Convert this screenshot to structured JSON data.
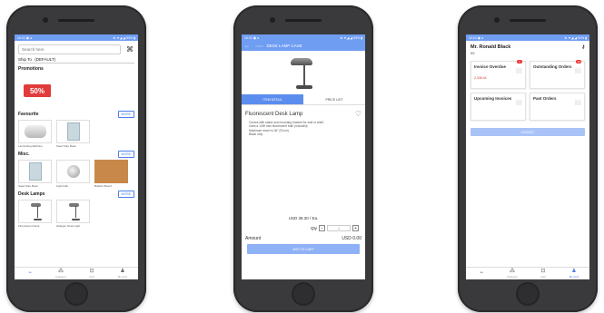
{
  "phone1": {
    "status": {
      "time": "10:22 ▣ ●",
      "right": "⊗ ▼◢ ◢ 93% ▮"
    },
    "search": {
      "placeholder": "Search here"
    },
    "scan_icon": "⌘",
    "ship_to": {
      "label": "Ship To",
      "value": "(DEFAULT)"
    },
    "promotions": {
      "title": "Promotions",
      "tag": "50%"
    },
    "favourite": {
      "title": "Favourite",
      "more": "MORE",
      "items": [
        "Laminating Machine",
        "Steel Note Book"
      ]
    },
    "misc": {
      "title": "Misc.",
      "more": "MORE",
      "items": [
        "Steel Note Book",
        "Light bulb",
        "Bulletin Board"
      ]
    },
    "desk_lamps": {
      "title": "Desk Lamps",
      "more": "MORE",
      "items": [
        "Fluorescent Desk",
        "Halogen Desk Light"
      ]
    },
    "nav": [
      {
        "icon": "⌁",
        "label": ""
      },
      {
        "icon": "⁂",
        "label": "Category"
      },
      {
        "icon": "⊡",
        "label": "Cart"
      },
      {
        "icon": "♟",
        "label": "My Acct"
      }
    ]
  },
  "phone2": {
    "status": {
      "time": "10:22 ▣ ●",
      "right": "⊗ ▼◢ ◢ 93% ▮"
    },
    "appbar": {
      "back": "←",
      "logo": "▭▭▭",
      "title": "DESK LAMP CASE"
    },
    "tabs": [
      "ITEM DETAIL",
      "PRICE LIST"
    ],
    "product": {
      "title": "Fluorescent Desk Lamp",
      "bullets": [
        "Comes with stand and mounting bracket for wall or shelf.",
        "Uses a 13W mini fluorescent bulb (included).",
        "Maximum reach is 36\" (91cm).",
        "Black only."
      ],
      "price": "USD  38.30 /  Ea.",
      "qty_label": "Qty",
      "qty_minus": "−",
      "qty_value": "1",
      "qty_plus": "+",
      "amount_label": "Amount",
      "amount_value": "USD  0.00",
      "add_to_cart": "ADD TO CART"
    }
  },
  "phone3": {
    "status": {
      "time": "10:24 ▣ ●",
      "right": "⊗ ▼◢ ◢ 94% ▮"
    },
    "customer": {
      "name": "Mr. Ronald Black",
      "id": "95"
    },
    "cards": [
      {
        "title": "Invoice Overdue",
        "value": "2,338.44",
        "badge": "1"
      },
      {
        "title": "Outstanding Orders",
        "value": "",
        "badge": "10"
      },
      {
        "title": "Upcoming Invoices",
        "value": "",
        "badge": ""
      },
      {
        "title": "Past Orders",
        "value": "",
        "badge": ""
      }
    ],
    "logout": "LOGOUT",
    "nav": [
      {
        "icon": "⌁",
        "label": ""
      },
      {
        "icon": "⁂",
        "label": "Category"
      },
      {
        "icon": "⊡",
        "label": "Cart"
      },
      {
        "icon": "♟",
        "label": "My Acct"
      }
    ]
  }
}
